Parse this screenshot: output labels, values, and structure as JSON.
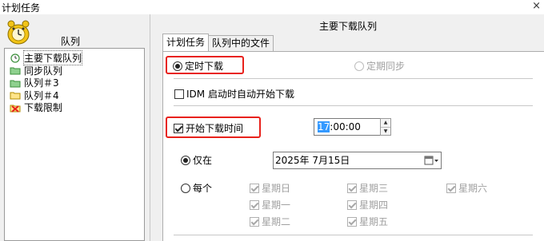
{
  "window": {
    "title": "计划任务",
    "close_glyph": "×"
  },
  "left": {
    "header_label": "队列",
    "items": [
      {
        "label": "主要下载队列",
        "icon": "queue-clock-icon",
        "selected": true
      },
      {
        "label": "同步队列",
        "icon": "folder-green-icon"
      },
      {
        "label": "队列＃3",
        "icon": "folder-green-icon"
      },
      {
        "label": "队列＃4",
        "icon": "folder-yellow-icon"
      },
      {
        "label": "下载限制",
        "icon": "red-x-folder-icon"
      }
    ]
  },
  "right": {
    "title": "主要下载队列",
    "tabs": [
      {
        "label": "计划任务",
        "active": true
      },
      {
        "label": "队列中的文件",
        "active": false
      }
    ],
    "mode": {
      "scheduled_label": "定时下载",
      "periodic_label": "定期同步"
    },
    "auto_start_label": "IDM 启动时自动开始下载",
    "start_time": {
      "label": "开始下载时间",
      "hour": "17",
      "rest": ":00:00"
    },
    "only_on": {
      "label": "仅在",
      "date": "2025年  7月15日"
    },
    "every": {
      "label": "每个",
      "days": [
        "星期日",
        "星期一",
        "星期二",
        "星期三",
        "星期四",
        "星期五",
        "星期六"
      ]
    }
  },
  "colors": {
    "highlight": "#e8211b",
    "selection": "#3399ff"
  }
}
